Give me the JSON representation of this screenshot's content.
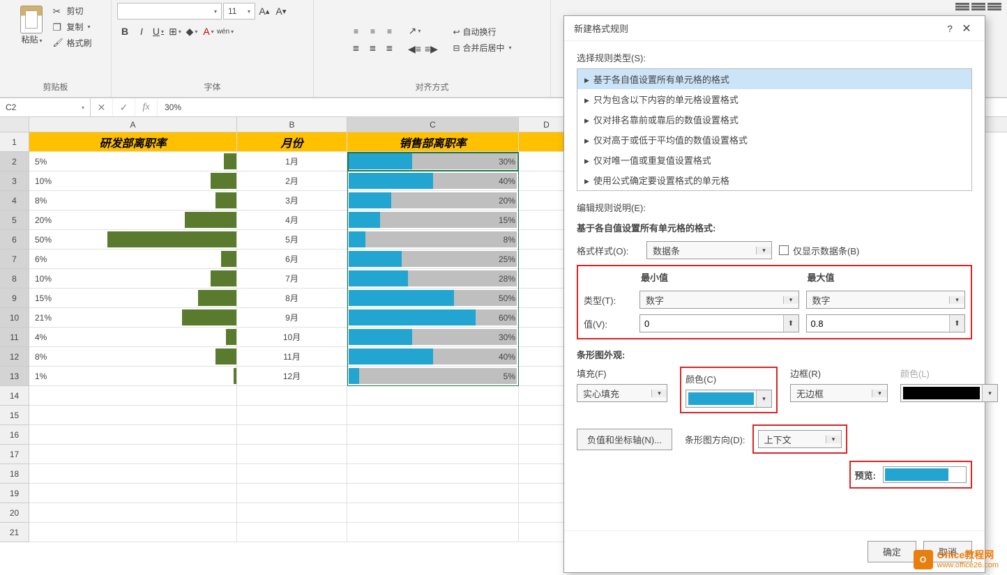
{
  "ribbon": {
    "paste_label": "粘贴",
    "cut_label": "剪切",
    "copy_label": "复制",
    "brush_label": "格式刷",
    "clipboard_group": "剪贴板",
    "font_group": "字体",
    "align_group": "对齐方式",
    "font_size": "11",
    "wrap_text": "自动换行",
    "merge_center": "合并后居中",
    "bold": "B",
    "italic": "I",
    "underline": "U",
    "wen": "wén"
  },
  "name_box": "C2",
  "formula_value": "30%",
  "columns": {
    "A": "A",
    "B": "B",
    "C": "C",
    "D": "D"
  },
  "headers": {
    "A": "研发部离职率",
    "B": "月份",
    "C": "销售部离职率"
  },
  "rows": [
    {
      "r": 1
    },
    {
      "r": 2,
      "a_pct": 5,
      "month": "1月",
      "c_pct": 30
    },
    {
      "r": 3,
      "a_pct": 10,
      "month": "2月",
      "c_pct": 40
    },
    {
      "r": 4,
      "a_pct": 8,
      "month": "3月",
      "c_pct": 20
    },
    {
      "r": 5,
      "a_pct": 20,
      "month": "4月",
      "c_pct": 15
    },
    {
      "r": 6,
      "a_pct": 50,
      "month": "5月",
      "c_pct": 8
    },
    {
      "r": 7,
      "a_pct": 6,
      "month": "6月",
      "c_pct": 25
    },
    {
      "r": 8,
      "a_pct": 10,
      "month": "7月",
      "c_pct": 28
    },
    {
      "r": 9,
      "a_pct": 15,
      "month": "8月",
      "c_pct": 50
    },
    {
      "r": 10,
      "a_pct": 21,
      "month": "9月",
      "c_pct": 60
    },
    {
      "r": 11,
      "a_pct": 4,
      "month": "10月",
      "c_pct": 30
    },
    {
      "r": 12,
      "a_pct": 8,
      "month": "11月",
      "c_pct": 40
    },
    {
      "r": 13,
      "a_pct": 1,
      "month": "12月",
      "c_pct": 5
    }
  ],
  "empty_rows": [
    14,
    15,
    16,
    17,
    18,
    19,
    20,
    21
  ],
  "dialog": {
    "title": "新建格式规则",
    "select_rule_type": "选择规则类型(S):",
    "rule_types": [
      "基于各自值设置所有单元格的格式",
      "只为包含以下内容的单元格设置格式",
      "仅对排名靠前或靠后的数值设置格式",
      "仅对高于或低于平均值的数值设置格式",
      "仅对唯一值或重复值设置格式",
      "使用公式确定要设置格式的单元格"
    ],
    "edit_desc": "编辑规则说明(E):",
    "format_all": "基于各自值设置所有单元格的格式:",
    "style_label": "格式样式(O):",
    "style_value": "数据条",
    "show_bar_only": "仅显示数据条(B)",
    "min_label": "最小值",
    "max_label": "最大值",
    "type_label": "类型(T):",
    "type_min": "数字",
    "type_max": "数字",
    "value_label": "值(V):",
    "value_min": "0",
    "value_max": "0.8",
    "bar_look": "条形图外观:",
    "fill_label": "填充(F)",
    "fill_value": "实心填充",
    "color_label": "颜色(C)",
    "border_label": "边框(R)",
    "border_value": "无边框",
    "color2_label": "颜色(L)",
    "neg_axis": "负值和坐标轴(N)...",
    "bar_dir": "条形图方向(D):",
    "bar_dir_value": "上下文",
    "preview": "预览:",
    "ok": "确定",
    "cancel": "取消",
    "fill_color": "#22a5d0",
    "border_color_swatch": "#000000"
  },
  "watermark": {
    "site1": "Office教程网",
    "site2": "www.office26.com",
    "badge": "O"
  }
}
